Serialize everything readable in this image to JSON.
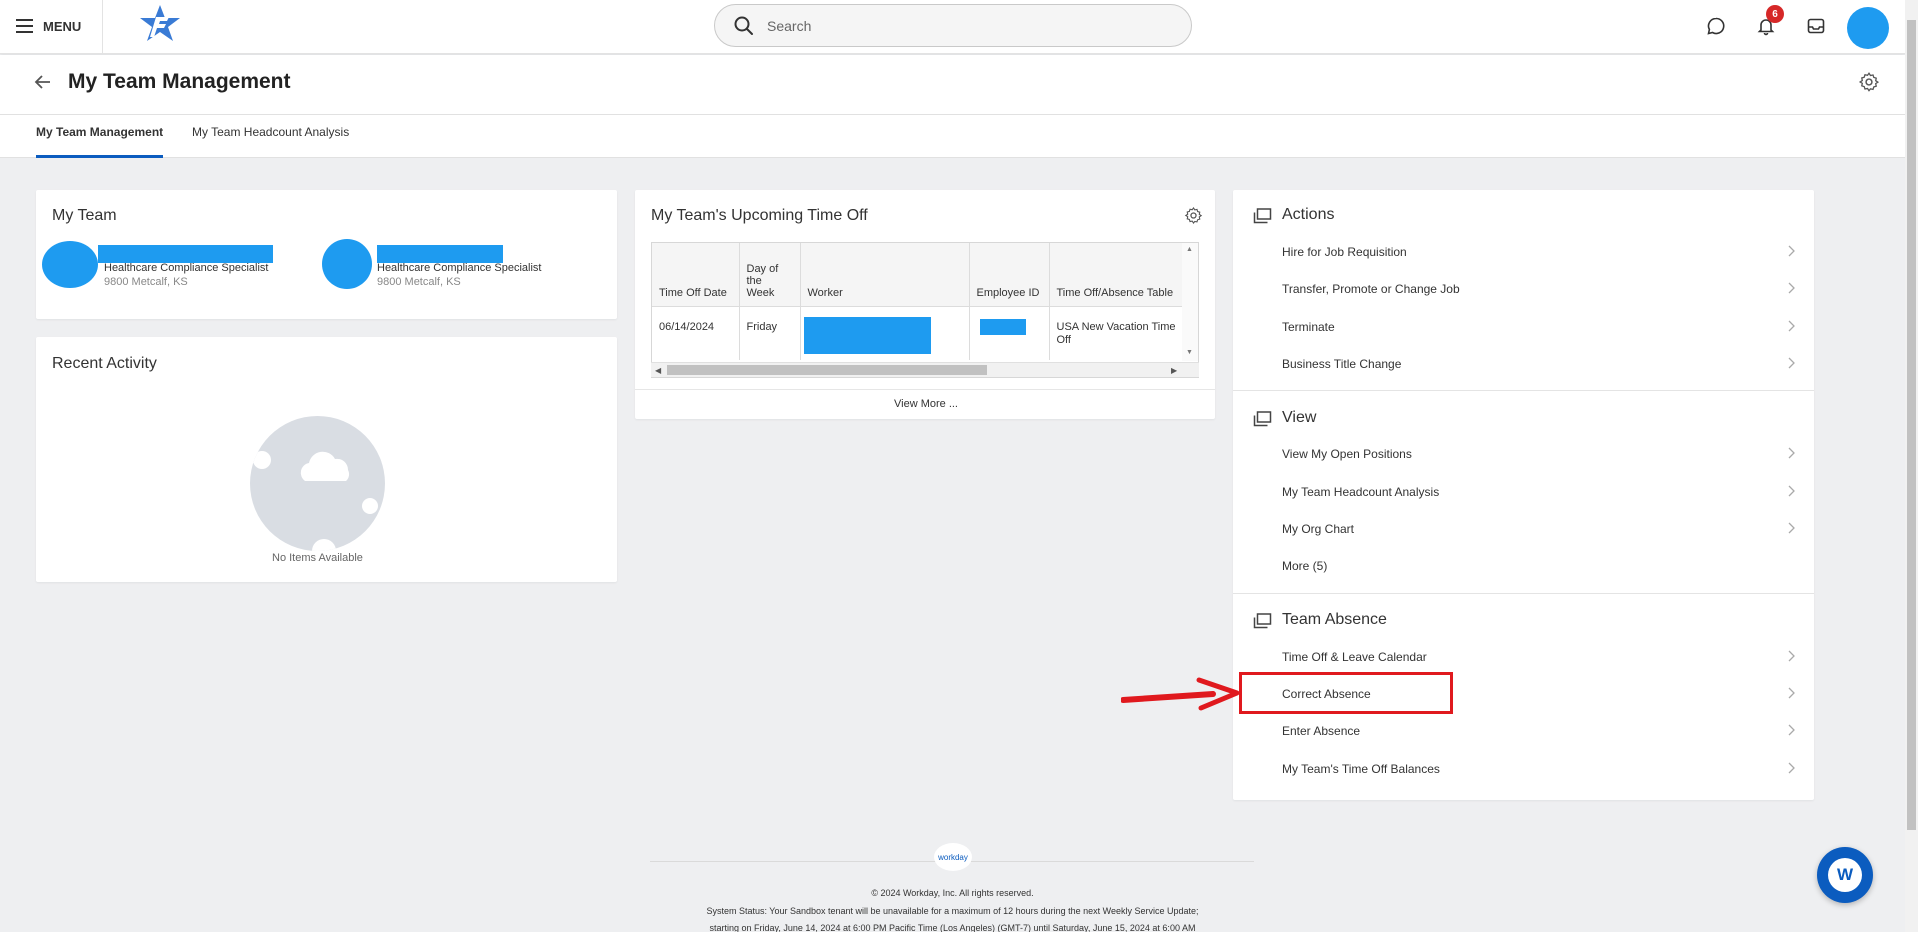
{
  "topbar": {
    "menu_label": "MENU",
    "search_placeholder": "Search",
    "notification_count": "6"
  },
  "header": {
    "title": "My Team Management",
    "tabs": [
      {
        "label": "My Team Management",
        "active": true
      },
      {
        "label": "My Team Headcount Analysis",
        "active": false
      }
    ]
  },
  "my_team": {
    "title": "My Team",
    "members": [
      {
        "role": "Healthcare Compliance Specialist",
        "location": "9800 Metcalf, KS"
      },
      {
        "role": "Healthcare Compliance Specialist",
        "location": "9800 Metcalf, KS"
      }
    ]
  },
  "recent_activity": {
    "title": "Recent Activity",
    "empty_text": "No Items Available"
  },
  "time_off": {
    "title": "My Team's Upcoming Time Off",
    "columns": [
      "Time Off Date",
      "Day of the Week",
      "Worker",
      "Employee ID",
      "Time Off/Absence Table"
    ],
    "rows": [
      {
        "date": "06/14/2024",
        "day": "Friday",
        "absence_table": "USA New Vacation Time Off"
      }
    ],
    "view_more": "View More ..."
  },
  "actions": {
    "sections": [
      {
        "title": "Actions",
        "items": [
          "Hire for Job Requisition",
          "Transfer, Promote or Change Job",
          "Terminate",
          "Business Title Change"
        ]
      },
      {
        "title": "View",
        "items": [
          "View My Open Positions",
          "My Team Headcount Analysis",
          "My Org Chart",
          "More (5)"
        ]
      },
      {
        "title": "Team Absence",
        "items": [
          "Time Off & Leave Calendar",
          "Correct Absence",
          "Enter Absence",
          "My Team's Time Off Balances"
        ]
      }
    ],
    "highlighted_item": "Correct Absence"
  },
  "footer": {
    "logo_text": "workday",
    "copyright": "© 2024 Workday, Inc. All rights reserved.",
    "status_line1": "System Status: Your Sandbox tenant will be unavailable for a maximum of 12 hours during the next Weekly Service Update;",
    "status_line2": "starting on Friday, June 14, 2024 at 6:00 PM Pacific Time (Los Angeles) (GMT-7) until Saturday, June 15, 2024 at 6:00 AM"
  },
  "colors": {
    "accent": "#0b5cbf",
    "redaction": "#1e9bf0",
    "highlight": "#e0191e",
    "badge": "#d62828"
  }
}
